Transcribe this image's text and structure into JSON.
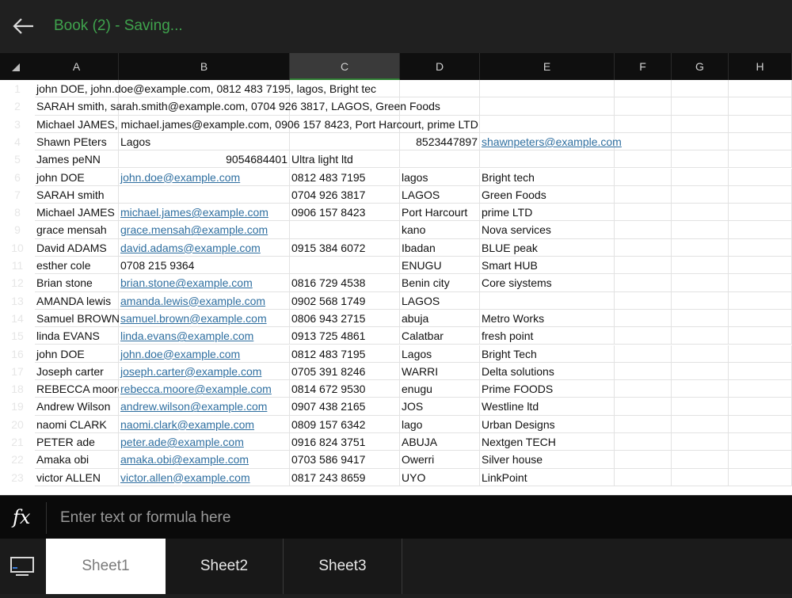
{
  "header": {
    "title": "Book (2) - Saving..."
  },
  "grid": {
    "columns": [
      "A",
      "B",
      "C",
      "D",
      "E",
      "F",
      "G",
      "H"
    ],
    "selected_column": "C",
    "rows": [
      {
        "n": "1",
        "cells": [
          {
            "c": "A",
            "t": "john DOE, john.doe@example.com, 0812 483 7195, lagos, Bright tec"
          }
        ]
      },
      {
        "n": "2",
        "cells": [
          {
            "c": "A",
            "t": "SARAH smith, sarah.smith@example.com, 0704 926 3817, LAGOS, Green Foods"
          }
        ]
      },
      {
        "n": "3",
        "cells": [
          {
            "c": "A",
            "t": "Michael  JAMES, michael.james@example.com, 0906 157 8423, Port Harcourt, prime LTD"
          }
        ]
      },
      {
        "n": "4",
        "cells": [
          {
            "c": "A",
            "t": "Shawn PEters"
          },
          {
            "c": "B",
            "t": "Lagos"
          },
          {
            "c": "D",
            "t": "8523447897",
            "k": "num"
          },
          {
            "c": "E",
            "t": "shawnpeters@example.com",
            "k": "link"
          }
        ]
      },
      {
        "n": "5",
        "cells": [
          {
            "c": "A",
            "t": "James peNN"
          },
          {
            "c": "B",
            "t": "9054684401",
            "k": "num"
          },
          {
            "c": "C",
            "t": "Ultra light ltd"
          }
        ]
      },
      {
        "n": "6",
        "cells": [
          {
            "c": "A",
            "t": "john DOE"
          },
          {
            "c": "B",
            "t": "john.doe@example.com",
            "k": "link"
          },
          {
            "c": "C",
            "t": "0812 483 7195"
          },
          {
            "c": "D",
            "t": "lagos"
          },
          {
            "c": "E",
            "t": "Bright tech"
          }
        ]
      },
      {
        "n": "7",
        "cells": [
          {
            "c": "A",
            "t": "SARAH smith"
          },
          {
            "c": "C",
            "t": "0704 926 3817"
          },
          {
            "c": "D",
            "t": "LAGOS"
          },
          {
            "c": "E",
            "t": "Green Foods"
          }
        ]
      },
      {
        "n": "8",
        "cells": [
          {
            "c": "A",
            "t": "Michael  JAMES"
          },
          {
            "c": "B",
            "t": "michael.james@example.com",
            "k": "link"
          },
          {
            "c": "C",
            "t": "0906 157 8423"
          },
          {
            "c": "D",
            "t": "Port Harcourt"
          },
          {
            "c": "E",
            "t": "prime LTD"
          }
        ]
      },
      {
        "n": "9",
        "cells": [
          {
            "c": "A",
            "t": "grace mensah"
          },
          {
            "c": "B",
            "t": "grace.mensah@example.com",
            "k": "link"
          },
          {
            "c": "D",
            "t": "kano"
          },
          {
            "c": "E",
            "t": "Nova services"
          }
        ]
      },
      {
        "n": "10",
        "cells": [
          {
            "c": "A",
            "t": "David ADAMS"
          },
          {
            "c": "B",
            "t": "david.adams@example.com",
            "k": "link"
          },
          {
            "c": "C",
            "t": "0915 384 6072"
          },
          {
            "c": "D",
            "t": "Ibadan"
          },
          {
            "c": "E",
            "t": "BLUE peak"
          }
        ]
      },
      {
        "n": "11",
        "cells": [
          {
            "c": "A",
            "t": "esther cole"
          },
          {
            "c": "B",
            "t": "0708 215 9364"
          },
          {
            "c": "D",
            "t": "ENUGU"
          },
          {
            "c": "E",
            "t": "Smart HUB"
          }
        ]
      },
      {
        "n": "12",
        "cells": [
          {
            "c": "A",
            "t": "Brian stone"
          },
          {
            "c": "B",
            "t": "brian.stone@example.com",
            "k": "link"
          },
          {
            "c": "C",
            "t": "0816 729 4538"
          },
          {
            "c": "D",
            "t": "Benin city"
          },
          {
            "c": "E",
            "t": "Core siystems"
          }
        ]
      },
      {
        "n": "13",
        "cells": [
          {
            "c": "A",
            "t": "AMANDA lewis"
          },
          {
            "c": "B",
            "t": "amanda.lewis@example.com",
            "k": "link"
          },
          {
            "c": "C",
            "t": "0902 568 1749"
          },
          {
            "c": "D",
            "t": "LAGOS"
          }
        ]
      },
      {
        "n": "14",
        "cells": [
          {
            "c": "A",
            "t": "Samuel BROWN",
            "k": "clip"
          },
          {
            "c": "B",
            "t": "samuel.brown@example.com",
            "k": "link"
          },
          {
            "c": "C",
            "t": "0806 943 2715"
          },
          {
            "c": "D",
            "t": "abuja"
          },
          {
            "c": "E",
            "t": "Metro Works"
          }
        ]
      },
      {
        "n": "15",
        "cells": [
          {
            "c": "A",
            "t": "linda EVANS"
          },
          {
            "c": "B",
            "t": "linda.evans@example.com",
            "k": "link"
          },
          {
            "c": "C",
            "t": "0913 725 4861"
          },
          {
            "c": "D",
            "t": "Calatbar"
          },
          {
            "c": "E",
            "t": "fresh point"
          }
        ]
      },
      {
        "n": "16",
        "cells": [
          {
            "c": "A",
            "t": "john DOE"
          },
          {
            "c": "B",
            "t": "john.doe@example.com",
            "k": "link"
          },
          {
            "c": "C",
            "t": "0812 483 7195"
          },
          {
            "c": "D",
            "t": "Lagos"
          },
          {
            "c": "E",
            "t": "Bright Tech"
          }
        ]
      },
      {
        "n": "17",
        "cells": [
          {
            "c": "A",
            "t": "Joseph carter"
          },
          {
            "c": "B",
            "t": "joseph.carter@example.com",
            "k": "link"
          },
          {
            "c": "C",
            "t": "0705 391 8246"
          },
          {
            "c": "D",
            "t": "WARRI"
          },
          {
            "c": "E",
            "t": "Delta solutions"
          }
        ]
      },
      {
        "n": "18",
        "cells": [
          {
            "c": "A",
            "t": "REBECCA moore",
            "k": "clip"
          },
          {
            "c": "B",
            "t": "rebecca.moore@example.com",
            "k": "link"
          },
          {
            "c": "C",
            "t": "0814 672 9530"
          },
          {
            "c": "D",
            "t": "enugu"
          },
          {
            "c": "E",
            "t": "Prime FOODS"
          }
        ]
      },
      {
        "n": "19",
        "cells": [
          {
            "c": "A",
            "t": "Andrew  Wilson"
          },
          {
            "c": "B",
            "t": "andrew.wilson@example.com",
            "k": "link"
          },
          {
            "c": "C",
            "t": "0907 438 2165"
          },
          {
            "c": "D",
            "t": "JOS"
          },
          {
            "c": "E",
            "t": "Westline ltd"
          }
        ]
      },
      {
        "n": "20",
        "cells": [
          {
            "c": "A",
            "t": "naomi CLARK"
          },
          {
            "c": "B",
            "t": "naomi.clark@example.com",
            "k": "link"
          },
          {
            "c": "C",
            "t": "0809 157 6342"
          },
          {
            "c": "D",
            "t": "lago"
          },
          {
            "c": "E",
            "t": "Urban Designs"
          }
        ]
      },
      {
        "n": "21",
        "cells": [
          {
            "c": "A",
            "t": "PETER ade"
          },
          {
            "c": "B",
            "t": "peter.ade@example.com",
            "k": "link"
          },
          {
            "c": "C",
            "t": "0916 824 3751"
          },
          {
            "c": "D",
            "t": "ABUJA"
          },
          {
            "c": "E",
            "t": "Nextgen TECH"
          }
        ]
      },
      {
        "n": "22",
        "cells": [
          {
            "c": "A",
            "t": "Amaka obi"
          },
          {
            "c": "B",
            "t": "amaka.obi@example.com",
            "k": "link"
          },
          {
            "c": "C",
            "t": "0703 586 9417"
          },
          {
            "c": "D",
            "t": "Owerri"
          },
          {
            "c": "E",
            "t": "Silver house"
          }
        ]
      },
      {
        "n": "23",
        "cells": [
          {
            "c": "A",
            "t": "victor ALLEN"
          },
          {
            "c": "B",
            "t": "victor.allen@example.com",
            "k": "link"
          },
          {
            "c": "C",
            "t": "0817 243 8659"
          },
          {
            "c": "D",
            "t": "UYO"
          },
          {
            "c": "E",
            "t": "LinkPoint"
          }
        ]
      }
    ]
  },
  "formula_bar": {
    "icon_label": "fx",
    "placeholder": "Enter text or formula here",
    "value": ""
  },
  "tabs": [
    {
      "label": "Sheet1",
      "active": true
    },
    {
      "label": "Sheet2",
      "active": false
    },
    {
      "label": "Sheet3",
      "active": false
    }
  ],
  "colors": {
    "title_green": "#3fa34d",
    "link_blue": "#2f6fa0",
    "header_bg": "#0f0f0f"
  }
}
